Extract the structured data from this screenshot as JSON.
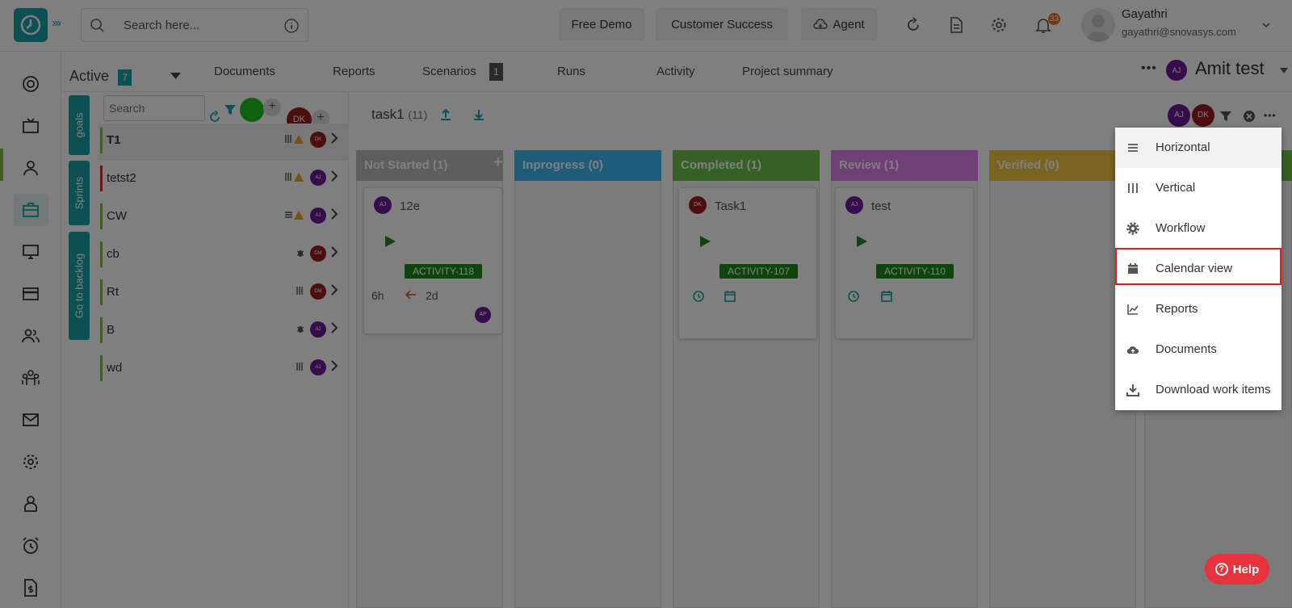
{
  "topbar": {
    "search_placeholder": "Search here...",
    "free_demo": "Free Demo",
    "customer_success": "Customer Success",
    "agent": "Agent",
    "notification_count": "33",
    "user_name": "Gayathri",
    "user_email": "gayathri@snovasys.com"
  },
  "subnav": {
    "status_label": "Active",
    "status_count": "7",
    "tabs": [
      {
        "label": "Documents"
      },
      {
        "label": "Reports"
      },
      {
        "label": "Scenarios",
        "count": "1"
      },
      {
        "label": "Runs"
      },
      {
        "label": "Activity"
      },
      {
        "label": "Project summary"
      }
    ],
    "project_avatar": "AJ",
    "project_name": "Amit test"
  },
  "side_tabs": [
    "goals",
    "Sprints",
    "Go to backlog"
  ],
  "goals_list": {
    "search_placeholder": "Search",
    "avatar_dk": "DK",
    "items": [
      {
        "label": "T1",
        "avatar": "DK",
        "bar_color": "#7fc142"
      },
      {
        "label": "tetst2",
        "avatar": "AJ",
        "bar_color": "#d32f2f"
      },
      {
        "label": "CW",
        "avatar": "AJ",
        "bar_color": "#7fc142"
      },
      {
        "label": "cb",
        "avatar": "DM",
        "bar_color": "#7fc142"
      },
      {
        "label": "Rt",
        "avatar": "DM",
        "bar_color": "#7fc142"
      },
      {
        "label": "B",
        "avatar": "AJ",
        "bar_color": "#7fc142"
      },
      {
        "label": "wd",
        "avatar": "AJ",
        "bar_color": "#7fc142"
      }
    ]
  },
  "board": {
    "title": "task1",
    "title_count": "(11)",
    "header_avatars": [
      "AJ",
      "DK"
    ],
    "columns": [
      {
        "label": "Not Started (1)",
        "color": "#bdbdbd"
      },
      {
        "label": "Inprogress (0)",
        "color": "#3db8f5"
      },
      {
        "label": "Completed (1)",
        "color": "#6cc04a"
      },
      {
        "label": "Review (1)",
        "color": "#e27ff0"
      },
      {
        "label": "Verified (0)",
        "color": "#f5c842"
      }
    ],
    "cards": [
      {
        "avatar": "AJ",
        "name": "12e",
        "activity": "ACTIVITY-118",
        "estimate": "6h",
        "due": "2d",
        "assignee": "AP"
      },
      {
        "avatar": "DK",
        "name": "Task1",
        "activity": "ACTIVITY-107"
      },
      {
        "avatar": "AJ",
        "name": "test",
        "activity": "ACTIVITY-110"
      }
    ]
  },
  "menu": {
    "items": [
      {
        "label": "Horizontal",
        "icon": "list-icon"
      },
      {
        "label": "Vertical",
        "icon": "columns-icon"
      },
      {
        "label": "Workflow",
        "icon": "gear-icon"
      },
      {
        "label": "Calendar view",
        "icon": "calendar-icon"
      },
      {
        "label": "Reports",
        "icon": "chart-icon"
      },
      {
        "label": "Documents",
        "icon": "cloud-icon"
      },
      {
        "label": "Download work items",
        "icon": "download-icon"
      }
    ]
  },
  "help_label": "Help",
  "colors": {
    "brand": "#17a2a6",
    "highlight": "#e02020",
    "help": "#e8333c"
  }
}
